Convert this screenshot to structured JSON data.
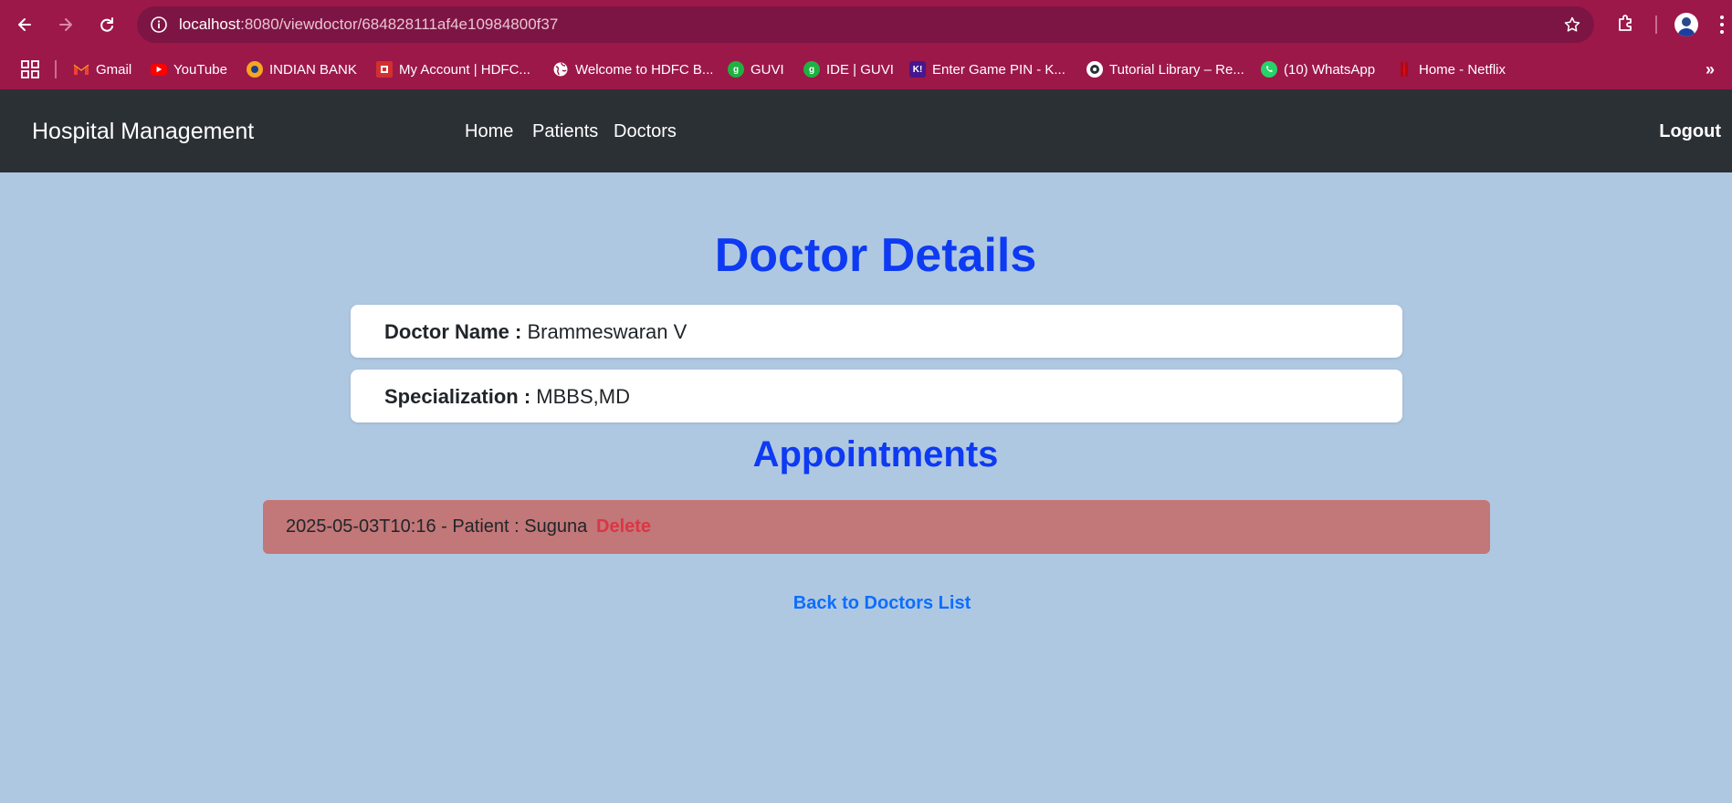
{
  "browser": {
    "url_host": "localhost",
    "url_rest": ":8080/viewdoctor/684828111af4e10984800f37",
    "bookmarks": [
      {
        "label": "Gmail",
        "icon": "gmail-icon",
        "color": "#ea4335"
      },
      {
        "label": "YouTube",
        "icon": "youtube-icon",
        "color": "#ff0000"
      },
      {
        "label": "INDIAN BANK",
        "icon": "indian-bank-icon",
        "color": "#f5a623"
      },
      {
        "label": "My Account | HDFC...",
        "icon": "hdfc-icon",
        "color": "#d32f2f"
      },
      {
        "label": "Welcome to HDFC B...",
        "icon": "globe-icon",
        "color": "#ffffff"
      },
      {
        "label": "GUVI",
        "icon": "guvi-icon",
        "color": "#1fb141"
      },
      {
        "label": "IDE | GUVI",
        "icon": "guvi-icon",
        "color": "#1fb141"
      },
      {
        "label": "Enter Game PIN - K...",
        "icon": "kahoot-icon",
        "color": "#46178f"
      },
      {
        "label": "Tutorial Library – Re...",
        "icon": "tutorial-library-icon",
        "color": "#2b3035"
      },
      {
        "label": "(10) WhatsApp",
        "icon": "whatsapp-icon",
        "color": "#25d366"
      },
      {
        "label": "Home - Netflix",
        "icon": "netflix-icon",
        "color": "#e50914"
      }
    ]
  },
  "navbar": {
    "brand": "Hospital Management",
    "links": [
      "Home",
      "Patients",
      "Doctors"
    ],
    "logout": "Logout"
  },
  "doctor": {
    "title": "Doctor Details",
    "name_label": "Doctor Name :",
    "name_value": "Brammeswaran V",
    "spec_label": "Specialization :",
    "spec_value": "MBBS,MD"
  },
  "appointments": {
    "title": "Appointments",
    "items": [
      {
        "text": "2025-05-03T10:16 - Patient : Suguna",
        "delete_label": "Delete"
      }
    ]
  },
  "back_link": "Back to Doctors List",
  "colors": {
    "chrome": "#9c1848",
    "navbar": "#2b3035",
    "page_bg": "#afc8e1",
    "heading": "#0d3af2",
    "appointment_bg": "#c27778",
    "delete": "#dc3545",
    "link": "#0d6efd"
  }
}
